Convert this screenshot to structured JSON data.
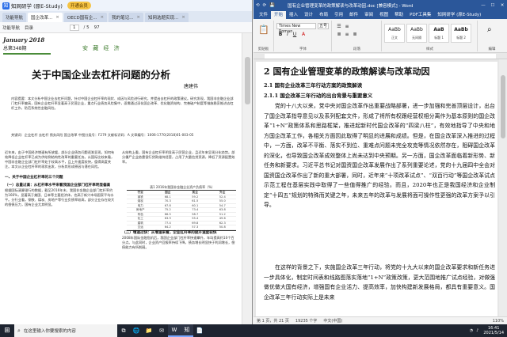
{
  "pdf": {
    "app_title": "知网研学 (原E-Study)",
    "vip_label": "开通会员",
    "tabs": [
      {
        "label": "功能导航"
      },
      {
        "label": "国企改革..."
      },
      {
        "label": "OECD国有企..."
      },
      {
        "label": "我的笔记..."
      },
      {
        "label": "知网选题实现..."
      }
    ],
    "toolbar": {
      "label1": "功能导航",
      "label2": "目录",
      "page_current": "1",
      "page_total": "/ 5",
      "zoom": "97"
    },
    "journal_month": "January 2018",
    "journal_volume": "总第348期",
    "section_tag": "安 藏 经 济",
    "title": "关于中国企业去杠杆问题的分析",
    "author": "唐建伟",
    "abstract": "内容提要：本文分析中国企业去杠杆问题，针对中国企业杠杆率的现状、成因与风险进行研究，并提出去杠杆的政策建议。研究发现，我国非金融企业部门杠杆率偏高，国有企业杠杆率显著高于民营企业，重点行业债务风险集中，亟需通过深化国企改革、优化融资结构、完善破产制度等措施稳妥推进去杠杆工作，防范系统性金融风险。",
    "keywords": "关键词：企业杠杆  去杠杆  债务风险  国企改革    中图分类号：F279    文献标识码：A    文章编号：1006-1770(2018)01-003-05",
    "col_left_intro": "近年来，由于中国经济增速有所放缓，部分企业债务问题逐渐显现，如何有效降低企业杠杆率已成为供给侧结构性改革的重要任务。从国际比较来看，中国非金融企业部门杠杆率处于较高水平，且上升速度较快，值得高度关注。本文从企业杠杆率的现状出发，分析其形成原因与潜在风险。",
    "col_left_heading": "一、关于中国企业杠杆率的三个问题",
    "col_left_sub": "（一）总量过高：从杠杆率水平来看我国企业部门杠杆率明显偏高",
    "col_left_body": "根据国际清算银行的数据，截至2016年末，我国非金融企业部门杠杆率约为166%，显著高于美国、日本等主要经济体，也高于新兴市场国家平均水平。分行业看，钢铁、煤炭、房地产等行业负债率较高，部分企业存在较大的偿债压力，国有企业尤其明显。",
    "col_right_body": "从结构上看，国有企业杠杆率明显高于民营企业，且近年来呈现分化态势。部分僵尸企业依靠银行贷款维持经营，占用了大量信贷资源，降低了资源配置效率。",
    "table_caption": "表1 2016年我国非金融企业资产负债率（%）",
    "table_rows": [
      [
        "行业",
        "国企",
        "民企",
        "外企"
      ],
      [
        "钢铁",
        "68.1",
        "59.2",
        "52.4"
      ],
      [
        "煤炭",
        "70.3",
        "61.5",
        "55.0"
      ],
      [
        "电力",
        "67.8",
        "60.1",
        "54.7"
      ],
      [
        "房地产",
        "75.2",
        "73.4",
        "63.8"
      ],
      [
        "有色",
        "66.5",
        "58.7",
        "51.2"
      ],
      [
        "化工",
        "63.9",
        "55.4",
        "49.6"
      ],
      [
        "建筑",
        "77.4",
        "69.8",
        "62.3"
      ],
      [
        "交运",
        "64.2",
        "57.3",
        "50.8"
      ]
    ],
    "col_right_heading": "（二）增速过快：从增速来看，企业杠杆率的提升速度较快",
    "col_right_body2": "2008年国际金融危机后，我国企业部门杠杆率快速攀升，年均提高约10个百分点。与此同时，企业资产回报率持续下降，债务增长明显快于利润增长，偿债能力有所削弱。"
  },
  "word": {
    "quick_access": [
      "⟲",
      "⟳",
      "💾"
    ],
    "doc_title": "国有企业管理变革的政策解读与改革动因.doc [兼容模式] - Word",
    "user": "知网研学 (原E-Study)",
    "window_controls": [
      "—",
      "☐",
      "✕"
    ],
    "tabs": [
      "文件",
      "开始",
      "插入",
      "设计",
      "布局",
      "引用",
      "邮件",
      "审阅",
      "视图",
      "帮助",
      "PDF工具集",
      "知网研学 (原E-Study)"
    ],
    "active_tab_index": 1,
    "ribbon": {
      "font_name": "Times New Roman",
      "font_size": "五号",
      "group_clipboard": "剪贴板",
      "group_font": "字体",
      "group_paragraph": "段落",
      "group_styles": "样式",
      "group_editing": "编辑",
      "styles": [
        {
          "sample": "AaBb",
          "name": "正文"
        },
        {
          "sample": "AaBb",
          "name": "无间隔"
        },
        {
          "sample": "AaB",
          "name": "标题 1"
        },
        {
          "sample": "AaBb",
          "name": "标题 2"
        }
      ]
    },
    "heading1": "2 国有企业管理变革的政策解读与改革动因",
    "heading2": "2.1 国有企业改革三年行动方案的政策解读",
    "heading3": "2.1.1 国企改革三年行动的出台背景与重要意义",
    "para1": "党的十八大以来，党中央对国企改革作出重要战略部署，进一步加强和完善顶层设计，出台了国企改革指导意见以及系列配套文件，形成了将所有权跟经营权相分离作为基本原则的国企改革“1+N”政策体系和思路框架，推进起新时代国企改革的“四梁八柱”，有效地指导了中央和地方国企改革工作，各相关方面因此取得了明显的进展和成绩。但是，在国企改革深入推进的过程中，一方面，改革不平衡、落实不到位、重难点问题未完全攻克等情况依然存在，阻碍国企改革的深化，也导致国企改革成效整体上尚未达到中央预期。另一方面，国企改革面临着新形势、新任务和新要求。习近平总书记对国资国企改革发展作出了系列重要论述，党的十九届四中全会对国资国企改革作出了新的重大部署，同时，近年来“十项改革试点”、“双百行动”等国企改革试点示范工程在基层实践中取得了一些值得推广的经验。而且，2020年也正是我国经济和企业制定“十四五”规划的特殊而关键之年，未来五年的改革与发展将面可操作性更强的改革方案予以引导。",
    "para2": "在这样的背景之下，实施国企改革三年行动，将党的十九大以来的国企改革要求和新任务进一步具体化，制定时间表和线路图落实落地“1+N”政策改策，更大范围地推广试点经验，对做强做优做大国有经济，增强国有企业活力、提高效率，加快构建新发展格局，都具有重要意义。国企改革三年行动实际上是未来",
    "status": {
      "page": "第 1 页，共 21 页",
      "words": "19235 个字",
      "lang": "中文(中国)",
      "zoom": "110%"
    }
  },
  "taskbar": {
    "search_placeholder": "在这里输入你要搜索的内容",
    "time": "16:41",
    "date": "2021/5/14",
    "apps": [
      "⧉",
      "🌐",
      "📁",
      "✉",
      "W",
      "知",
      "📄"
    ]
  }
}
